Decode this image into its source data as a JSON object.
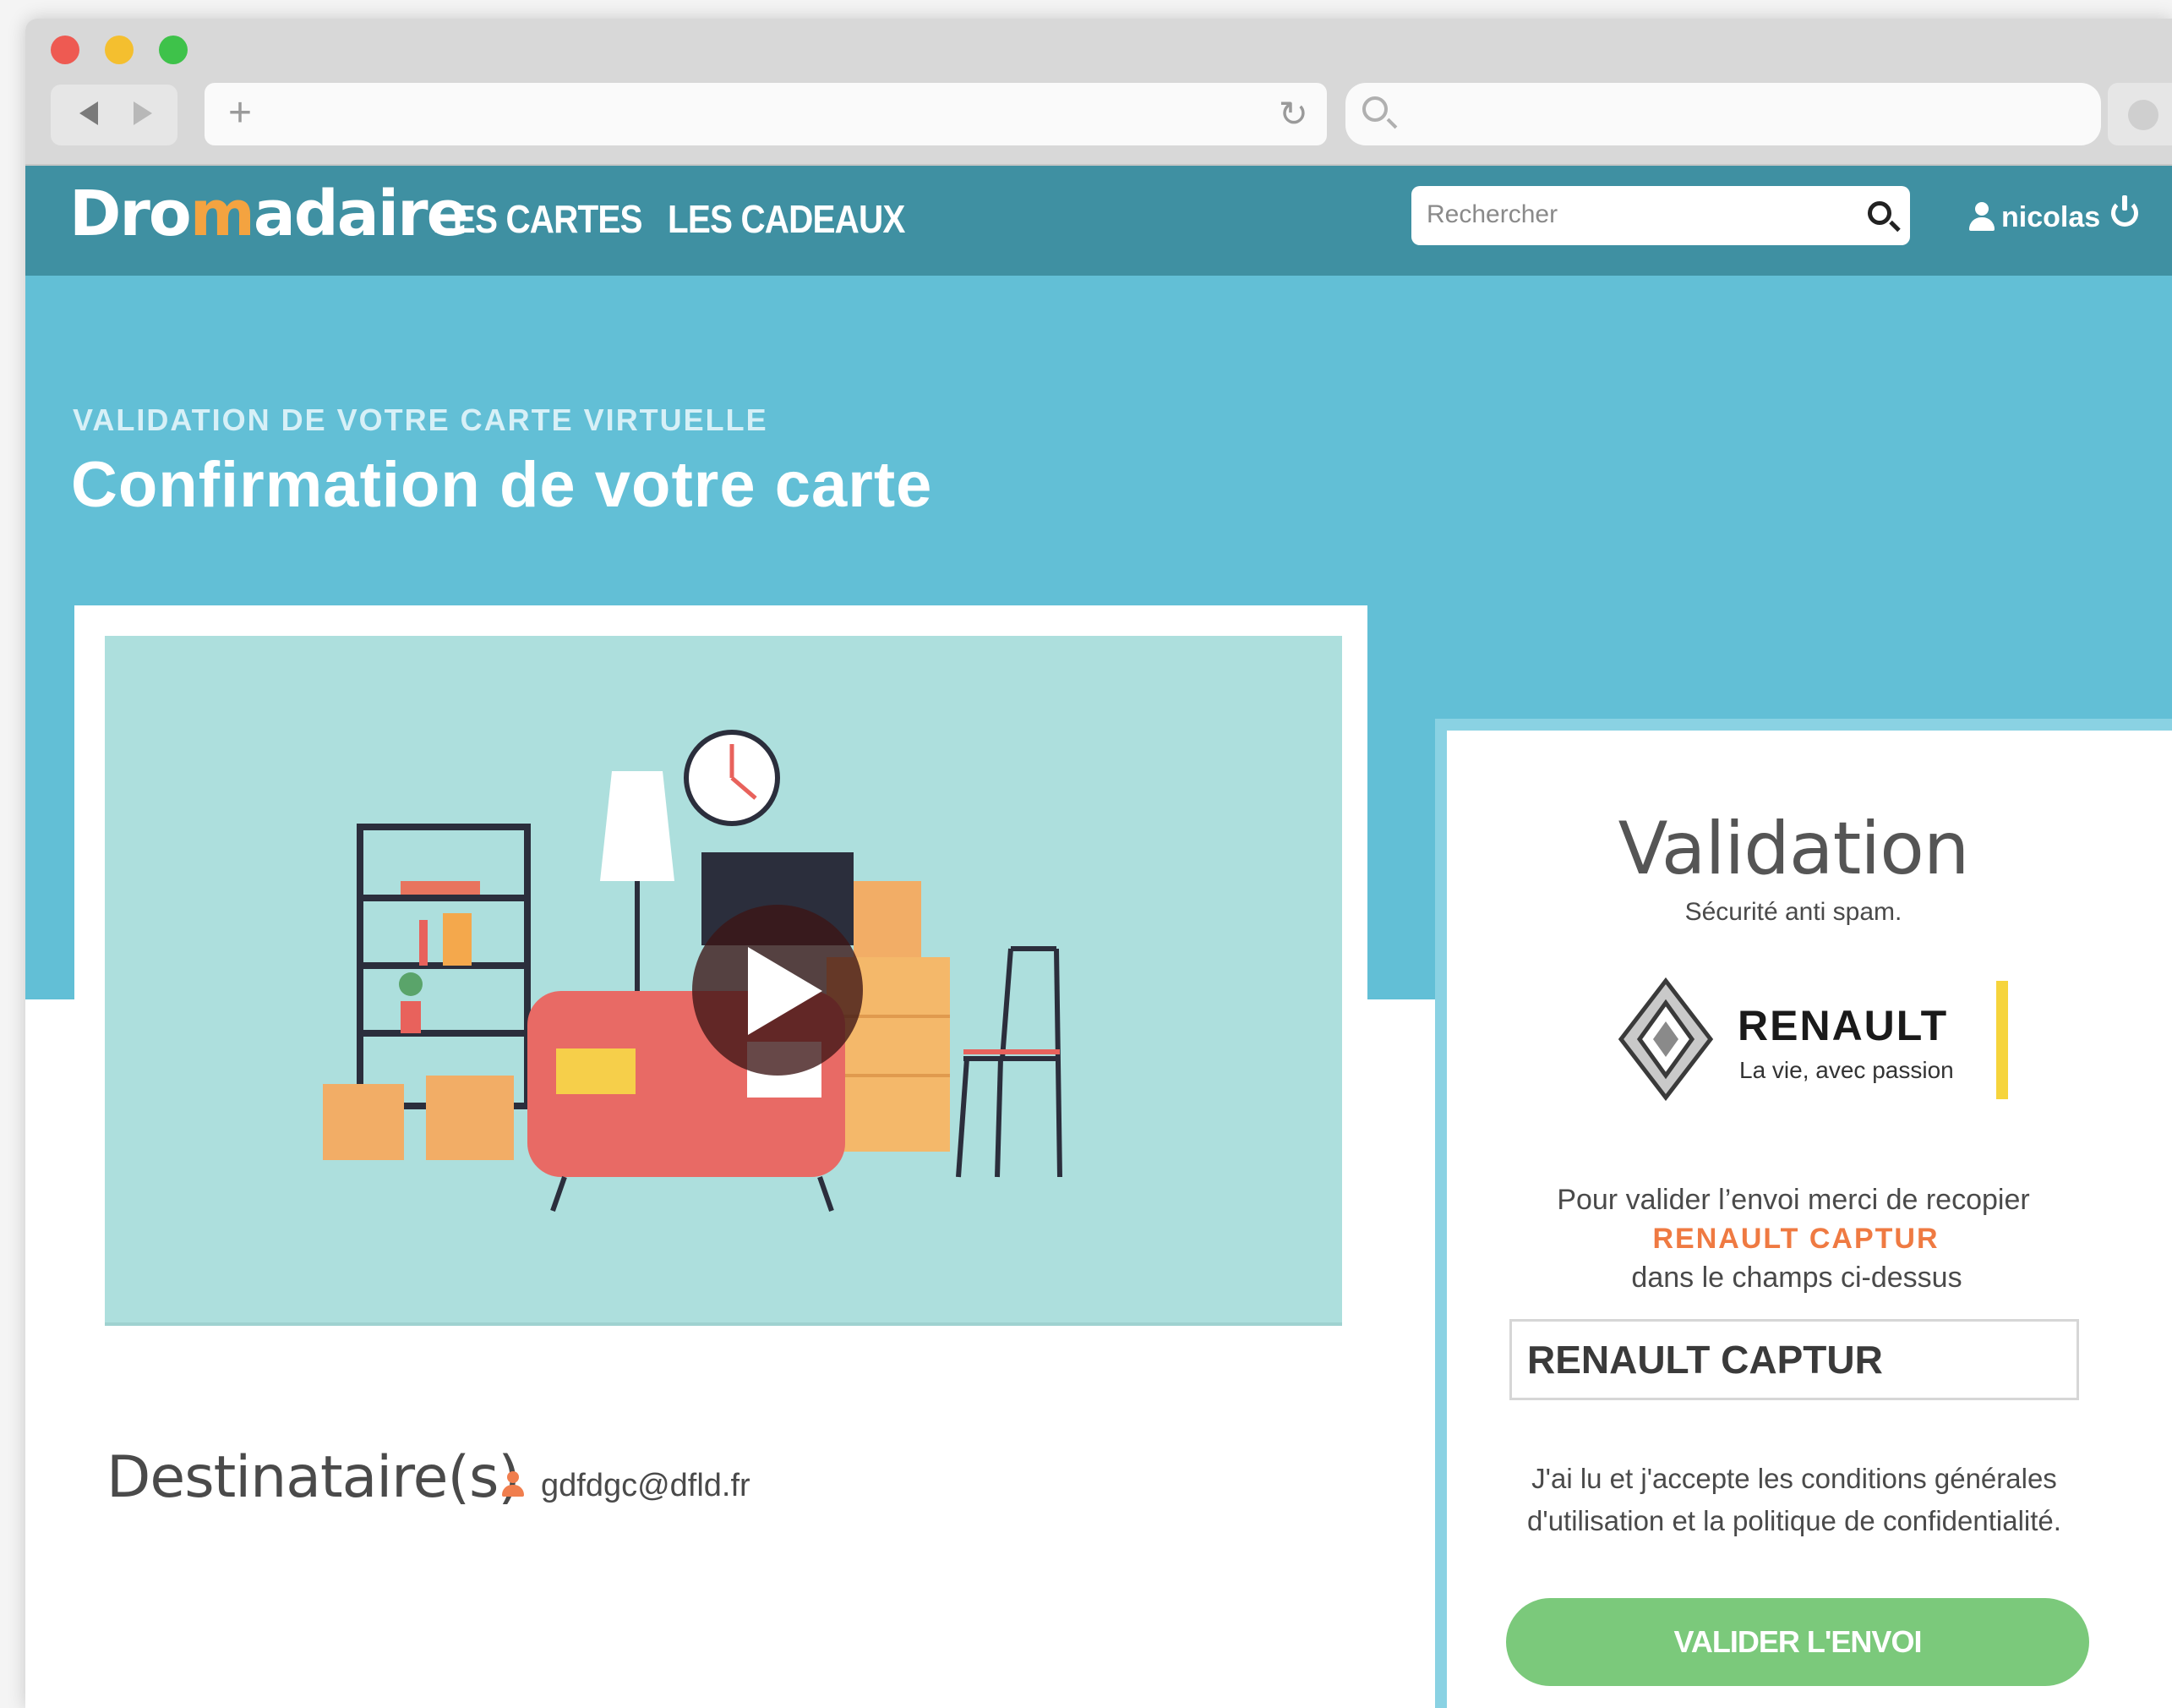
{
  "header": {
    "logo_prefix": "Dro",
    "logo_m": "m",
    "logo_suffix": "adaire",
    "nav": [
      "LES CARTES",
      "LES CADEAUX"
    ],
    "search_placeholder": "Rechercher",
    "username": "nicolas"
  },
  "hero": {
    "subtitle": "VALIDATION DE VOTRE CARTE VIRTUELLE",
    "title": "Confirmation de votre carte"
  },
  "recipient": {
    "label": "Destinataire(s)",
    "email": "gdfdgc@dfld.fr"
  },
  "validation": {
    "title": "Validation",
    "subtitle": "Sécurité anti spam.",
    "brand": {
      "name": "RENAULT",
      "tagline": "La vie, avec passion",
      "bar_color": "#f6d43c"
    },
    "instruction_line1": "Pour valider l’envoi merci de recopier",
    "captcha_code": "RENAULT CAPTUR",
    "instruction_line2": "dans le champs ci-dessus",
    "input_value": "RENAULT CAPTUR",
    "terms_line1": "J'ai lu et j'accepte les conditions générales",
    "terms_line2": "d'utilisation et la politique de confidentialité.",
    "submit_label": "VALIDER L'ENVOI"
  },
  "colors": {
    "header_bg": "#3f90a2",
    "hero_bg": "#62bfd6",
    "accent_orange": "#ef7a42",
    "button_green": "#7bc97b"
  }
}
